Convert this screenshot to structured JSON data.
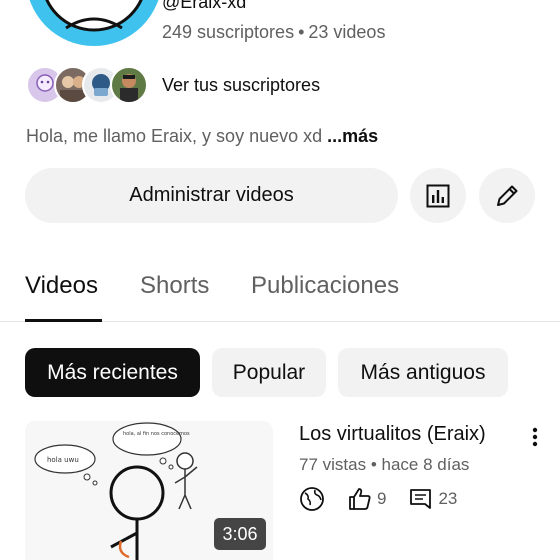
{
  "channel": {
    "handle": "@Eraix-xd",
    "subscribers": "249 suscriptores",
    "videos_count": "23 videos",
    "separator": "•",
    "view_subscribers_label": "Ver tus suscriptores",
    "description": "Hola, me llamo Eraix, y soy nuevo xd",
    "more_label": "...más",
    "avatar_color": "#3fc3ee"
  },
  "actions": {
    "manage_videos_label": "Administrar videos",
    "stats_icon": "bar-chart-icon",
    "edit_icon": "pencil-icon"
  },
  "tabs": [
    {
      "label": "Videos",
      "active": true
    },
    {
      "label": "Shorts",
      "active": false
    },
    {
      "label": "Publicaciones",
      "active": false
    }
  ],
  "filters": [
    {
      "label": "Más recientes",
      "selected": true
    },
    {
      "label": "Popular",
      "selected": false
    },
    {
      "label": "Más antiguos",
      "selected": false
    }
  ],
  "videos": [
    {
      "title": "Los virtualitos (Eraix)",
      "views": "77 vistas",
      "age": "hace 8 días",
      "duration": "3:06",
      "likes": "9",
      "comments": "23",
      "thumb_bubble_left": "hola uwu",
      "thumb_bubble_right": "hola, al fin nos conocemos"
    }
  ]
}
